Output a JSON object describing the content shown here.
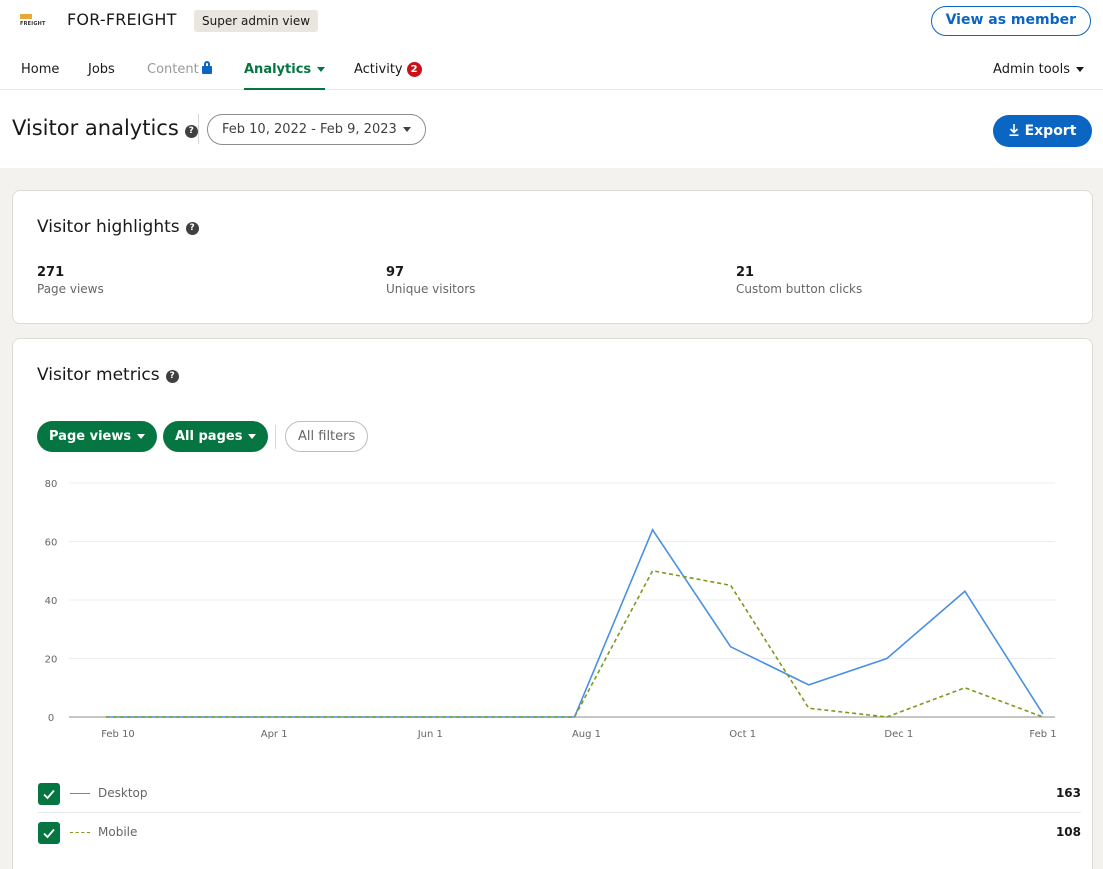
{
  "org": {
    "name": "FOR-FREIGHT",
    "logo_text": "FREIGHT",
    "admin_badge": "Super admin view"
  },
  "header": {
    "view_as_member": "View as member"
  },
  "nav": {
    "home": "Home",
    "jobs": "Jobs",
    "content": "Content",
    "analytics": "Analytics",
    "activity": "Activity",
    "activity_badge": "2",
    "admin_tools": "Admin tools"
  },
  "page": {
    "title": "Visitor analytics",
    "date_range": "Feb 10, 2022 - Feb 9, 2023",
    "export_label": "Export"
  },
  "highlights": {
    "title": "Visitor highlights",
    "stats": [
      {
        "value": "271",
        "label": "Page views"
      },
      {
        "value": "97",
        "label": "Unique visitors"
      },
      {
        "value": "21",
        "label": "Custom button clicks"
      }
    ]
  },
  "metrics": {
    "title": "Visitor metrics",
    "filters": {
      "metric": "Page views",
      "pages": "All pages",
      "all_filters": "All filters"
    },
    "legend": [
      {
        "name": "Desktop",
        "total": "163",
        "color": "#4a90e2",
        "style": "solid"
      },
      {
        "name": "Mobile",
        "total": "108",
        "color": "#7a9a1e",
        "style": "dashed"
      }
    ]
  },
  "colors": {
    "accent_green": "#057642",
    "brand_blue": "#0a66c2",
    "desktop_line": "#4a90e2",
    "mobile_line": "#7a9a1e"
  },
  "chart_data": {
    "type": "line",
    "x": [
      "Feb 10",
      "Mar 13",
      "Apr 12",
      "May 13",
      "Jun 12",
      "Jul 13",
      "Aug 12",
      "Sep 12",
      "Oct 12",
      "Nov 11",
      "Dec 12",
      "Jan 11",
      "Feb 9"
    ],
    "tick_labels": [
      "Feb 10",
      "Apr 1",
      "Jun 1",
      "Aug 1",
      "Oct 1",
      "Dec 1",
      "Feb 1"
    ],
    "ylim": [
      0,
      80
    ],
    "yticks": [
      0,
      20,
      40,
      60,
      80
    ],
    "grid": true,
    "series": [
      {
        "name": "Desktop",
        "values": [
          0,
          0,
          0,
          0,
          0,
          0,
          0,
          64,
          24,
          11,
          20,
          43,
          1
        ]
      },
      {
        "name": "Mobile",
        "values": [
          0,
          0,
          0,
          0,
          0,
          0,
          0,
          50,
          45,
          3,
          0,
          10,
          0
        ]
      }
    ]
  }
}
